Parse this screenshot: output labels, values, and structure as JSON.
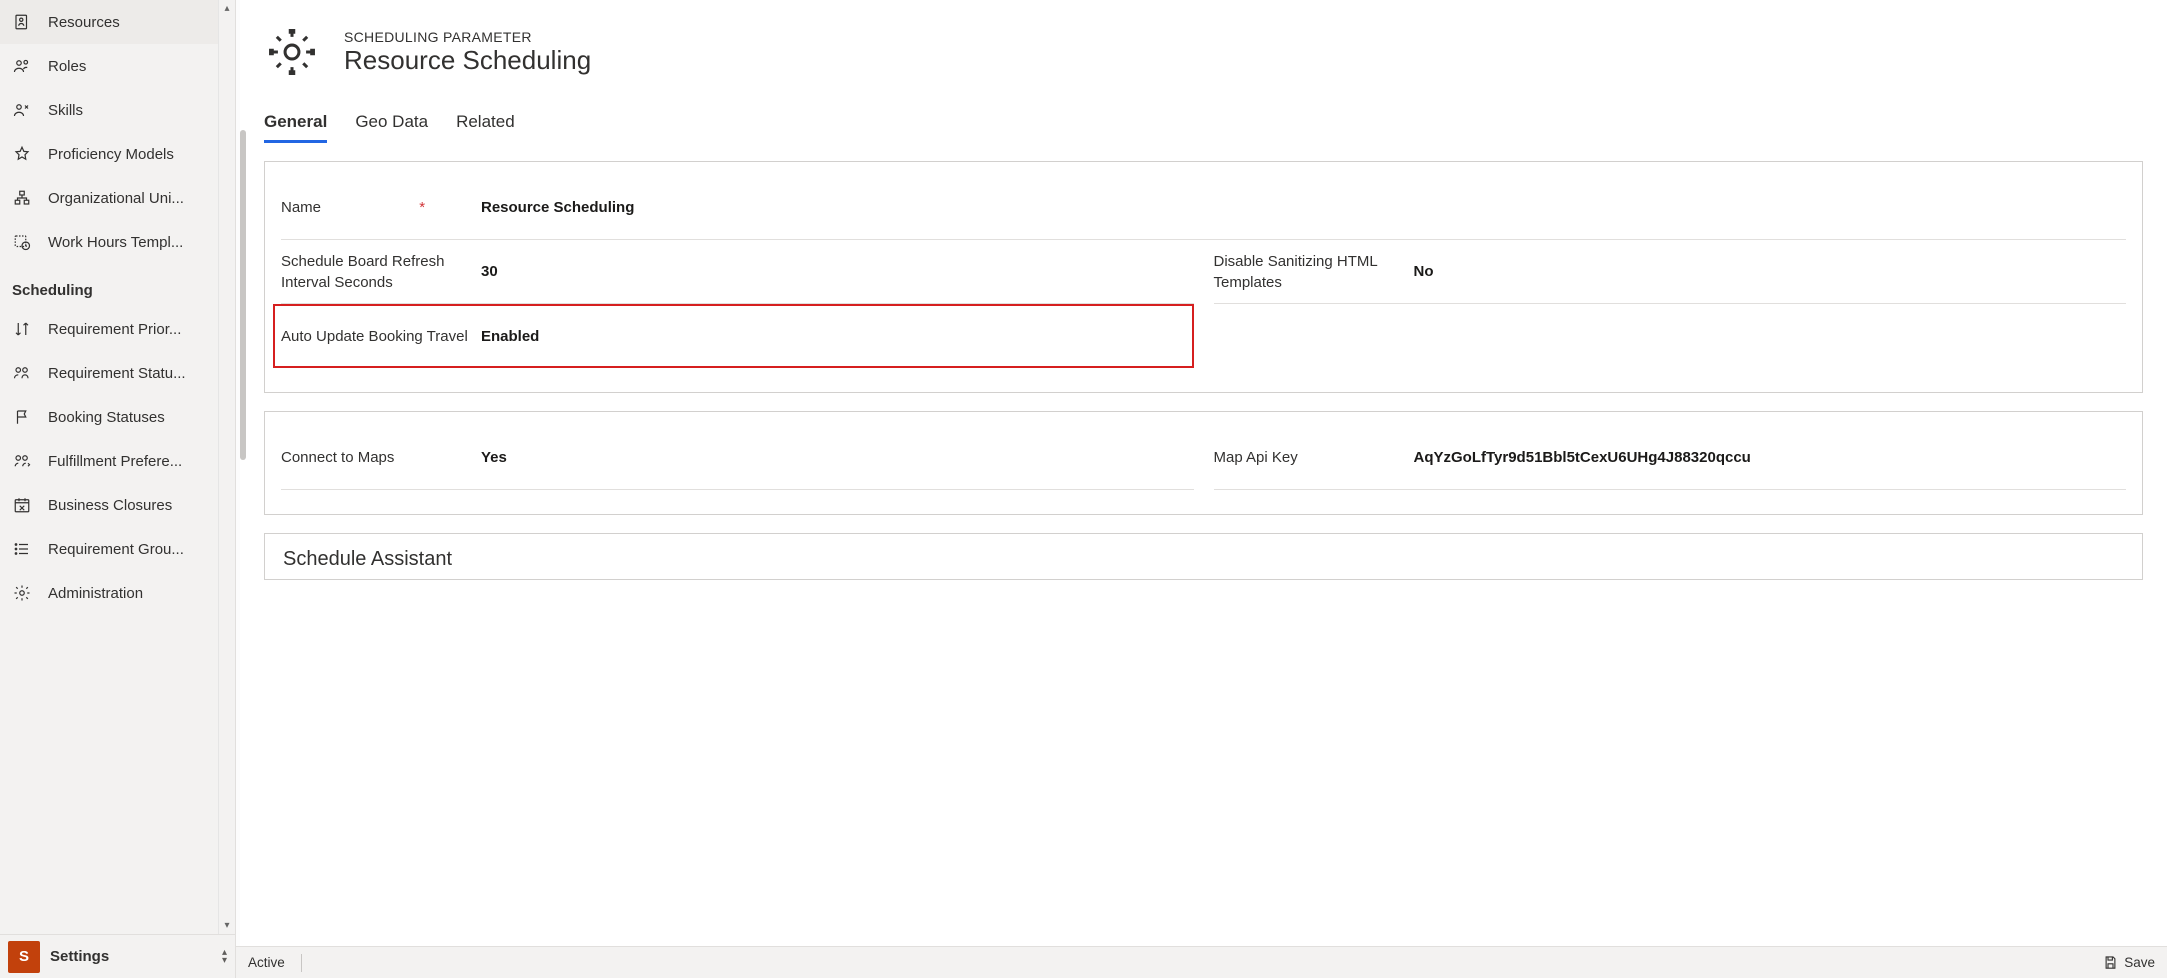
{
  "sidebar": {
    "items_top": [
      {
        "label": "Resources",
        "icon": "resources"
      },
      {
        "label": "Roles",
        "icon": "roles"
      },
      {
        "label": "Skills",
        "icon": "skills"
      },
      {
        "label": "Proficiency Models",
        "icon": "star"
      },
      {
        "label": "Organizational Uni...",
        "icon": "org"
      },
      {
        "label": "Work Hours Templ...",
        "icon": "workhours"
      }
    ],
    "group_header": "Scheduling",
    "items_scheduling": [
      {
        "label": "Requirement Prior...",
        "icon": "priority"
      },
      {
        "label": "Requirement Statu...",
        "icon": "reqstatus"
      },
      {
        "label": "Booking Statuses",
        "icon": "flag"
      },
      {
        "label": "Fulfillment Prefere...",
        "icon": "fulfill"
      },
      {
        "label": "Business Closures",
        "icon": "calendar-x"
      },
      {
        "label": "Requirement Grou...",
        "icon": "list"
      },
      {
        "label": "Administration",
        "icon": "gear"
      }
    ],
    "area": {
      "badge": "S",
      "label": "Settings"
    }
  },
  "header": {
    "eyebrow": "SCHEDULING PARAMETER",
    "title": "Resource Scheduling"
  },
  "tabs": [
    {
      "label": "General",
      "active": true
    },
    {
      "label": "Geo Data",
      "active": false
    },
    {
      "label": "Related",
      "active": false
    }
  ],
  "form": {
    "name_label": "Name",
    "name_value": "Resource Scheduling",
    "refresh_label": "Schedule Board Refresh Interval Seconds",
    "refresh_value": "30",
    "disable_sanitize_label": "Disable Sanitizing HTML Templates",
    "disable_sanitize_value": "No",
    "auto_update_label": "Auto Update Booking Travel",
    "auto_update_value": "Enabled",
    "connect_maps_label": "Connect to Maps",
    "connect_maps_value": "Yes",
    "map_api_key_label": "Map Api Key",
    "map_api_key_value": "AqYzGoLfTyr9d51Bbl5tCexU6UHg4J88320qccu"
  },
  "section2_title": "Schedule Assistant",
  "statusbar": {
    "state": "Active",
    "save_label": "Save"
  }
}
